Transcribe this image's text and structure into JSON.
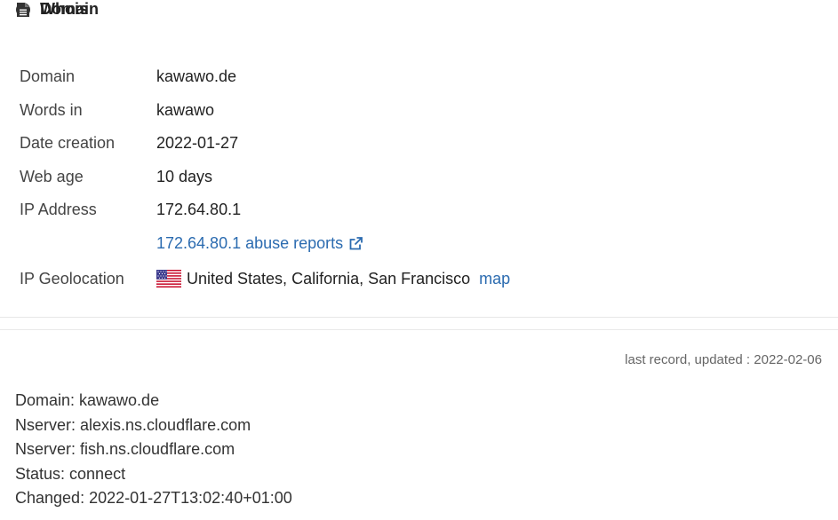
{
  "domain_section": {
    "title": "Domain",
    "rows": {
      "domain": {
        "label": "Domain",
        "value": "kawawo.de"
      },
      "words_in": {
        "label": "Words in",
        "value": "kawawo"
      },
      "date_creation": {
        "label": "Date creation",
        "value": "2022-01-27"
      },
      "web_age": {
        "label": "Web age",
        "value": "10 days"
      },
      "ip_address": {
        "label": "IP Address",
        "value": "172.64.80.1"
      },
      "abuse_reports": {
        "label": "",
        "value": "172.64.80.1 abuse reports"
      },
      "ip_geolocation": {
        "label": "IP Geolocation",
        "value": "United States, California, San Francisco",
        "map_label": "map"
      }
    },
    "icons": {
      "section": "globe-icon",
      "external": "external-link-icon",
      "flag": "us-flag-icon"
    }
  },
  "whois_section": {
    "title": "Whois",
    "updated": "last record, updated : 2022-02-06",
    "lines": [
      "Domain: kawawo.de",
      "Nserver: alexis.ns.cloudflare.com",
      "Nserver: fish.ns.cloudflare.com",
      "Status: connect",
      "Changed: 2022-01-27T13:02:40+01:00"
    ],
    "icons": {
      "section": "document-icon"
    }
  },
  "colors": {
    "link": "#2b6bb0",
    "text": "#222222",
    "muted": "#666666"
  }
}
